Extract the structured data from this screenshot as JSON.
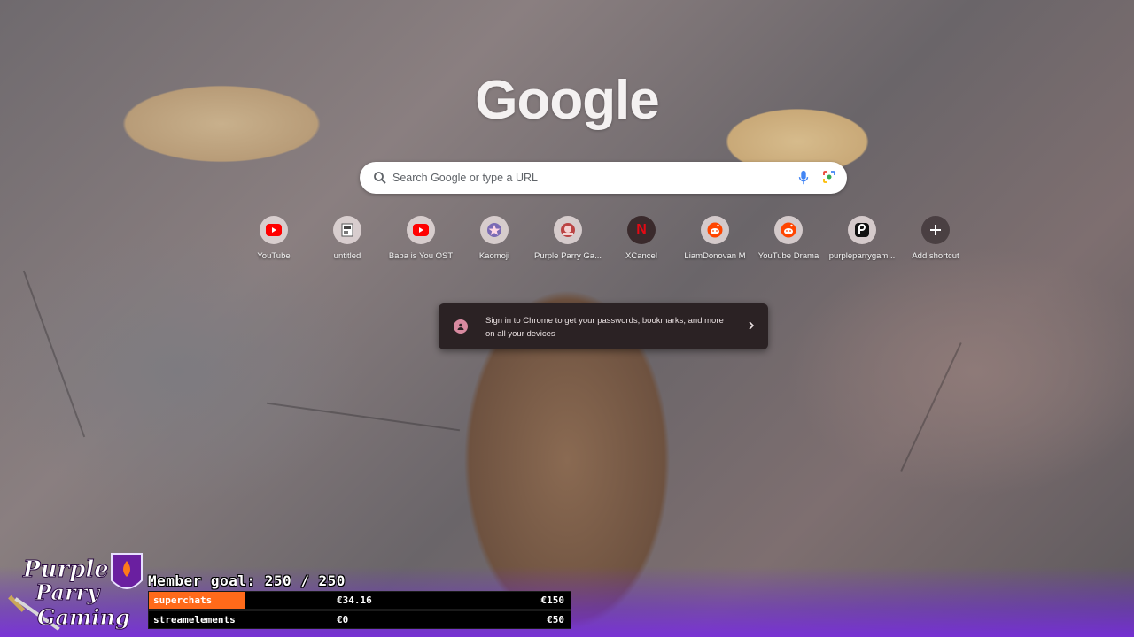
{
  "google": {
    "logo_text": "Google"
  },
  "search": {
    "placeholder": "Search Google or type a URL"
  },
  "shortcuts": [
    {
      "label": "YouTube",
      "icon": "youtube-icon"
    },
    {
      "label": "untitled",
      "icon": "document-icon"
    },
    {
      "label": "Baba is You OST",
      "icon": "youtube-icon"
    },
    {
      "label": "Kaomoji",
      "icon": "star-icon"
    },
    {
      "label": "Purple Parry Ga...",
      "icon": "bird-icon"
    },
    {
      "label": "XCancel",
      "icon": "n-logo-icon"
    },
    {
      "label": "LiamDonovan M",
      "icon": "reddit-icon"
    },
    {
      "label": "YouTube Drama",
      "icon": "reddit-icon"
    },
    {
      "label": "purpleparrygam...",
      "icon": "app-icon"
    },
    {
      "label": "Add shortcut",
      "icon": "plus-icon"
    }
  ],
  "signin": {
    "text": "Sign in to Chrome to get your passwords, bookmarks, and more on all your devices"
  },
  "overlay": {
    "member_goal": "Member goal: 250 / 250",
    "bars": [
      {
        "name": "superchats",
        "current": "€34.16",
        "target": "€150",
        "progress": 0.23,
        "color": "#ff6a1a"
      },
      {
        "name": "streamelements",
        "current": "€0",
        "target": "€50",
        "progress": 0,
        "color": "#ff6a1a"
      }
    ]
  },
  "colors": {
    "accent": "#7a2ee6",
    "toast_bg": "#2b2224"
  }
}
